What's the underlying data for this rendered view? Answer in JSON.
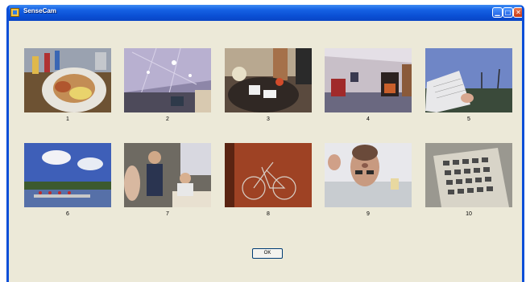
{
  "window": {
    "title": "SenseCam"
  },
  "titlebar": {
    "minimize_icon": "minimize-icon",
    "maximize_icon": "maximize-icon",
    "close_icon": "close-icon",
    "accent": "#0a4fd4"
  },
  "images": [
    {
      "label": "1",
      "content": "meal on plate"
    },
    {
      "label": "2",
      "content": "office ceiling"
    },
    {
      "label": "3",
      "content": "table with lamp"
    },
    {
      "label": "4",
      "content": "living room"
    },
    {
      "label": "5",
      "content": "reading paper outdoors"
    },
    {
      "label": "6",
      "content": "rowing on river"
    },
    {
      "label": "7",
      "content": "people in kitchen"
    },
    {
      "label": "8",
      "content": "bicycle in room"
    },
    {
      "label": "9",
      "content": "face from below"
    },
    {
      "label": "10",
      "content": "newspaper page"
    }
  ],
  "buttons": {
    "ok_label": "OK"
  }
}
